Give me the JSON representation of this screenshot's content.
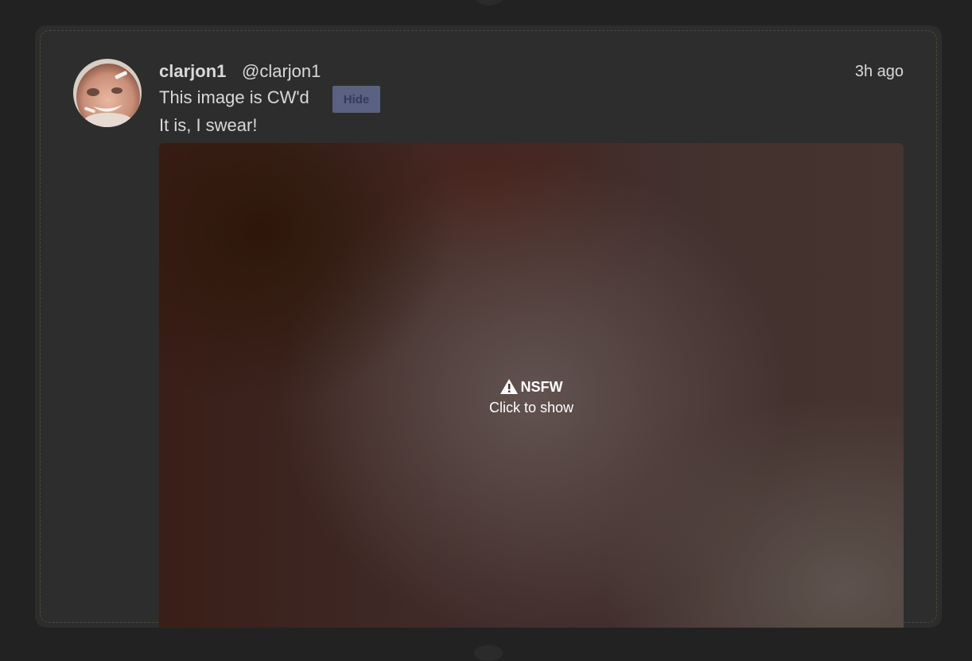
{
  "post": {
    "display_name": "clarjon1",
    "handle": "@clarjon1",
    "timestamp": "3h ago",
    "content_warning": "This image is CW'd",
    "hide_label": "Hide",
    "body": "It is, I swear!"
  },
  "media": {
    "nsfw_label": "NSFW",
    "reveal_hint": "Click to show",
    "icon": "warning-triangle-icon"
  },
  "colors": {
    "background": "#222222",
    "card": "#2d2d2d",
    "text": "#d9d9d9",
    "hide_button": "#5a6181"
  }
}
